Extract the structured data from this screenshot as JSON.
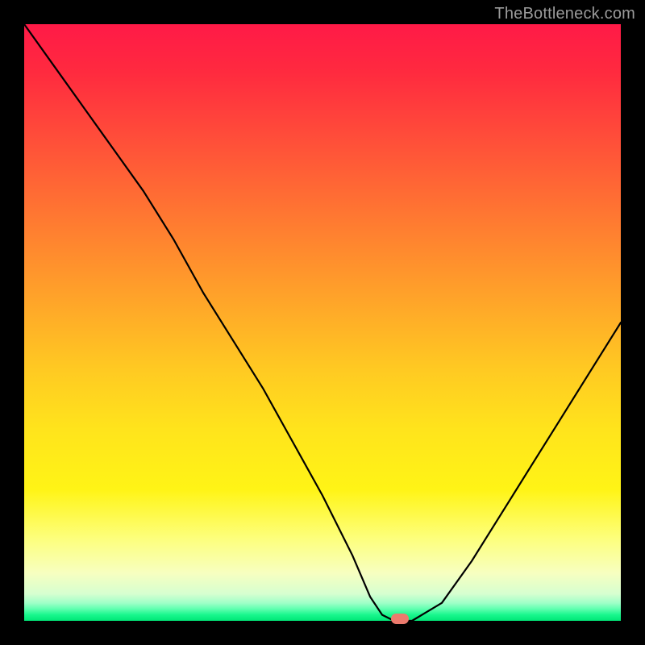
{
  "watermark": "TheBottleneck.com",
  "chart_data": {
    "type": "line",
    "title": "",
    "xlabel": "",
    "ylabel": "",
    "xlim": [
      0,
      100
    ],
    "ylim": [
      0,
      100
    ],
    "x": [
      0,
      5,
      10,
      15,
      20,
      25,
      30,
      35,
      40,
      45,
      50,
      55,
      58,
      60,
      62,
      65,
      70,
      75,
      80,
      85,
      90,
      95,
      100
    ],
    "values": [
      100,
      93,
      86,
      79,
      72,
      64,
      55,
      47,
      39,
      30,
      21,
      11,
      4,
      1,
      0,
      0,
      3,
      10,
      18,
      26,
      34,
      42,
      50
    ],
    "marker": {
      "x": 63,
      "y": 0
    },
    "gradient_description": "vertical red-to-green heat gradient (red top, green bottom)"
  }
}
